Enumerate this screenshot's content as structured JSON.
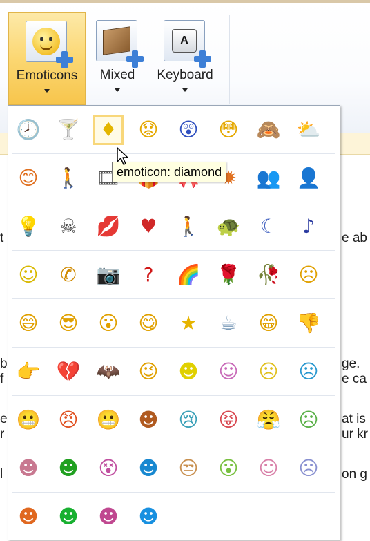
{
  "ribbon": {
    "buttons": [
      {
        "label": "Emoticons",
        "icon": "emoticon-insert-icon",
        "active": true
      },
      {
        "label": "Mixed",
        "icon": "box-insert-icon",
        "active": false
      },
      {
        "label": "Keyboard",
        "icon": "keyboard-insert-icon",
        "key_letter": "A",
        "active": false
      }
    ]
  },
  "document_fragments": {
    "left": [
      "t",
      "b",
      "f",
      "e",
      "r",
      "l"
    ],
    "right": [
      "e ab",
      "ge.",
      "e ca",
      "at is",
      "ur kr",
      "on g"
    ]
  },
  "tooltip": "emoticon: diamond",
  "emoticons": [
    [
      {
        "glyph": "🕗",
        "name": "clock",
        "color": "#3a66b0"
      },
      {
        "glyph": "🍸",
        "name": "martini",
        "color": "#8bb0a0"
      },
      {
        "glyph": "♦",
        "name": "diamond",
        "color": "#e3b500",
        "selected": true
      },
      {
        "glyph": "😟",
        "name": "worried",
        "color": "#e5a800"
      },
      {
        "glyph": "😲",
        "name": "shocked",
        "color": "#3050c0"
      },
      {
        "glyph": "😳",
        "name": "flushed",
        "color": "#e5a800"
      },
      {
        "glyph": "🙈",
        "name": "hiding",
        "color": "#d08a00"
      },
      {
        "glyph": "⛅",
        "name": "cloud",
        "color": "#7fa6d8"
      }
    ],
    [
      {
        "glyph": "😊",
        "name": "blushing",
        "color": "#e07020"
      },
      {
        "glyph": "🚶",
        "name": "person",
        "color": "#3a6ac0"
      },
      {
        "glyph": "🎞",
        "name": "film",
        "color": "#555555"
      },
      {
        "glyph": "🎁",
        "name": "gift",
        "color": "#a07838"
      },
      {
        "glyph": "🎀",
        "name": "present",
        "color": "#2a58b8"
      },
      {
        "glyph": "✹",
        "name": "sun",
        "color": "#e07020"
      },
      {
        "glyph": "👥",
        "name": "chatting",
        "color": "#3a9a3a"
      },
      {
        "glyph": "👤",
        "name": "contact",
        "color": "#8a3030"
      }
    ],
    [
      {
        "glyph": "💡",
        "name": "lightbulb",
        "color": "#e8c000"
      },
      {
        "glyph": "☠",
        "name": "skull",
        "color": "#333333"
      },
      {
        "glyph": "💋",
        "name": "lips",
        "color": "#d02020"
      },
      {
        "glyph": "♥",
        "name": "heart",
        "color": "#d02828"
      },
      {
        "glyph": "🚶",
        "name": "walking-man",
        "color": "#2a8a3a"
      },
      {
        "glyph": "🐢",
        "name": "turtle",
        "color": "#2a7a8a"
      },
      {
        "glyph": "☾",
        "name": "moon",
        "color": "#4060c0"
      },
      {
        "glyph": "♪",
        "name": "music-note",
        "color": "#2a3aa0"
      }
    ],
    [
      {
        "glyph": "☺",
        "name": "smiley",
        "color": "#d8b800"
      },
      {
        "glyph": "✆",
        "name": "phone",
        "color": "#d08a00"
      },
      {
        "glyph": "📷",
        "name": "camera",
        "color": "#666666"
      },
      {
        "glyph": "?",
        "name": "question-mark",
        "color": "#d01818"
      },
      {
        "glyph": "🌈",
        "name": "rainbow",
        "color": "#e05030"
      },
      {
        "glyph": "🌹",
        "name": "rose",
        "color": "#c02020"
      },
      {
        "glyph": "🥀",
        "name": "wilted-rose",
        "color": "#c02020"
      },
      {
        "glyph": "☹",
        "name": "sad",
        "color": "#e0a000"
      }
    ],
    [
      {
        "glyph": "😄",
        "name": "laughing",
        "color": "#e0a000"
      },
      {
        "glyph": "😎",
        "name": "cool",
        "color": "#e0a000"
      },
      {
        "glyph": "😮",
        "name": "surprised",
        "color": "#e0a000"
      },
      {
        "glyph": "😋",
        "name": "tongue-out",
        "color": "#e0a000"
      },
      {
        "glyph": "★",
        "name": "star",
        "color": "#e6b400"
      },
      {
        "glyph": "☕",
        "name": "coffee",
        "color": "#7a9ab8"
      },
      {
        "glyph": "😁",
        "name": "grinning",
        "color": "#e0a000"
      },
      {
        "glyph": "👎",
        "name": "thumbs-down",
        "color": "#d09000"
      }
    ],
    [
      {
        "glyph": "👉",
        "name": "pointing-hand",
        "color": "#e0a000"
      },
      {
        "glyph": "💔",
        "name": "broken-heart",
        "color": "#c83030"
      },
      {
        "glyph": "🦇",
        "name": "bat",
        "color": "#333333"
      },
      {
        "glyph": "😉",
        "name": "wink",
        "color": "#e0a000"
      },
      {
        "glyph": "☻",
        "name": "yellow-smiley",
        "color": "#e0d000"
      },
      {
        "glyph": "☺",
        "name": "purple-smiley",
        "color": "#c86ab8"
      },
      {
        "glyph": "☹",
        "name": "confused",
        "color": "#e0c020"
      },
      {
        "glyph": "☹",
        "name": "blue-face",
        "color": "#2a98d0"
      }
    ],
    [
      {
        "glyph": "😬",
        "name": "teal-grimace",
        "color": "#2a98c0"
      },
      {
        "glyph": "😠",
        "name": "angry",
        "color": "#e05020"
      },
      {
        "glyph": "😬",
        "name": "green-grin",
        "color": "#5aa030"
      },
      {
        "glyph": "☻",
        "name": "brown-face",
        "color": "#b05a20"
      },
      {
        "glyph": "😢",
        "name": "crying",
        "color": "#3aa0b8"
      },
      {
        "glyph": "😝",
        "name": "pink-face",
        "color": "#d84850"
      },
      {
        "glyph": "😤",
        "name": "frowning-blue",
        "color": "#4060b0"
      },
      {
        "glyph": "☹",
        "name": "green-sad",
        "color": "#5ab048"
      }
    ],
    [
      {
        "glyph": "☻",
        "name": "pink-laugh",
        "color": "#c87890"
      },
      {
        "glyph": "☻",
        "name": "green-face",
        "color": "#20a020"
      },
      {
        "glyph": "😵",
        "name": "dizzy-face",
        "color": "#c050a0"
      },
      {
        "glyph": "☻",
        "name": "blue-wink",
        "color": "#1888d0"
      },
      {
        "glyph": "😒",
        "name": "tan-face",
        "color": "#c89050"
      },
      {
        "glyph": "😮",
        "name": "green-gasp",
        "color": "#78c040"
      },
      {
        "glyph": "☺",
        "name": "pink-smile",
        "color": "#d880a8"
      },
      {
        "glyph": "☹",
        "name": "lavender-face",
        "color": "#8890d0"
      }
    ],
    [
      {
        "glyph": "☻",
        "name": "orange-face",
        "color": "#e06820"
      },
      {
        "glyph": "☻",
        "name": "bright-green-face",
        "color": "#18b030"
      },
      {
        "glyph": "☻",
        "name": "magenta-face",
        "color": "#c04890"
      },
      {
        "glyph": "☻",
        "name": "blue-face-2",
        "color": "#1890e0"
      }
    ]
  ]
}
